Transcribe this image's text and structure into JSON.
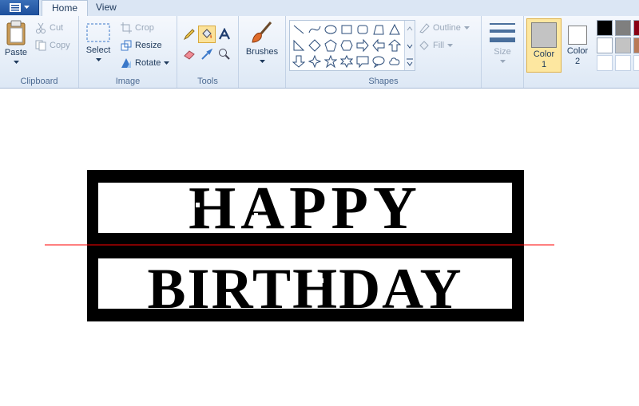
{
  "tabs": [
    {
      "label": "Home"
    },
    {
      "label": "View"
    }
  ],
  "clipboard": {
    "paste": "Paste",
    "cut": "Cut",
    "copy": "Copy",
    "group": "Clipboard"
  },
  "image": {
    "select": "Select",
    "crop": "Crop",
    "resize": "Resize",
    "rotate": "Rotate",
    "group": "Image"
  },
  "tools": {
    "group": "Tools"
  },
  "brushes": {
    "label": "Brushes"
  },
  "shapes": {
    "outline": "Outline",
    "fill": "Fill",
    "group": "Shapes"
  },
  "size": {
    "label": "Size"
  },
  "colors": {
    "color1": "Color 1",
    "color2": "Color 2",
    "color1_value": "#c3c3c3",
    "color2_value": "#ffffff",
    "palette": [
      "#000000",
      "#7f7f7f",
      "#880015",
      "#ffffff",
      "#c3c3c3",
      "#b97a57",
      "#ffffff",
      "#ffffff",
      "#ffffff"
    ]
  },
  "canvas": {
    "line1": "HAPPY",
    "line2": "BIRTHDAY"
  }
}
